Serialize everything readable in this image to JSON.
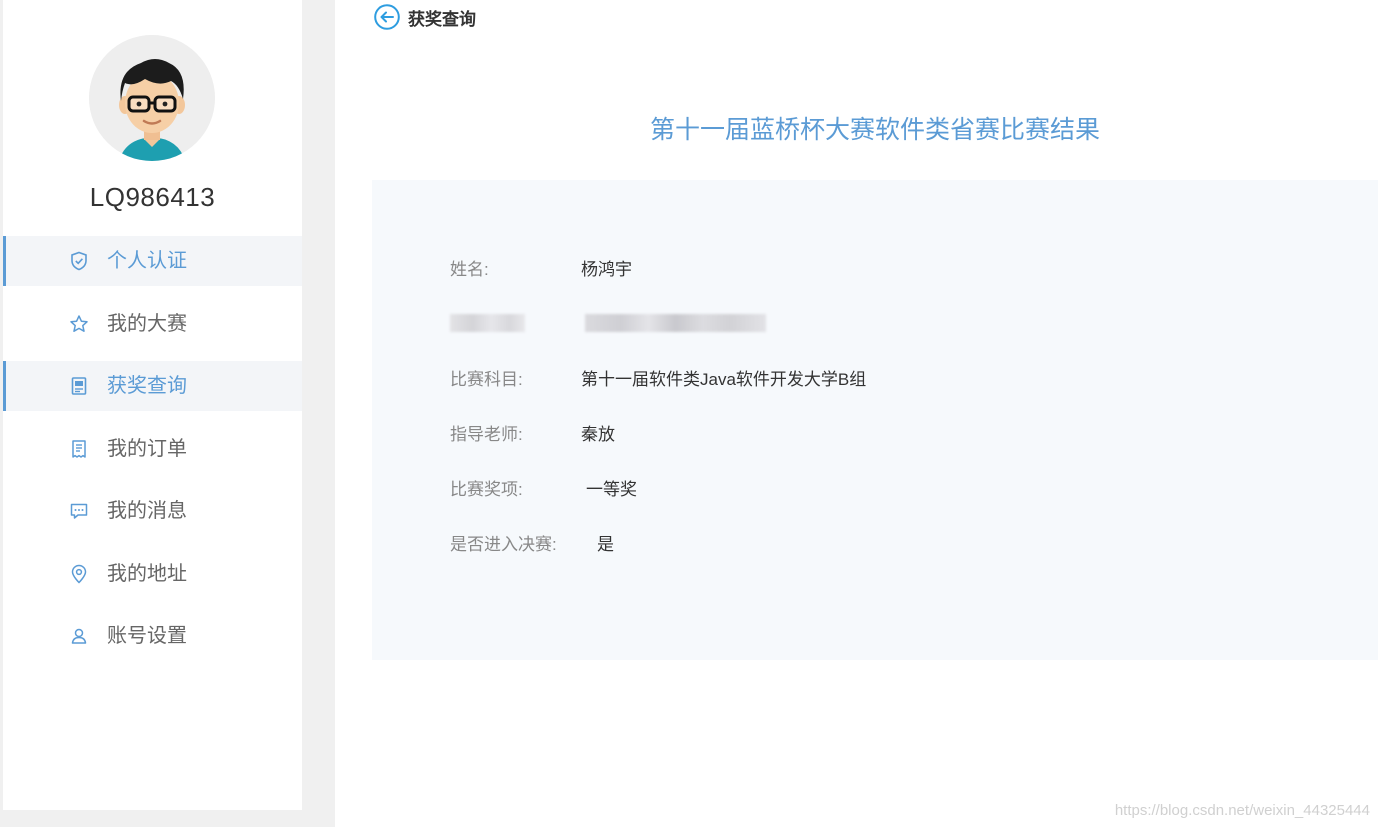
{
  "user": {
    "username": "LQ986413"
  },
  "sidebar": {
    "items": [
      {
        "label": "个人认证",
        "icon": "shield-check-icon",
        "active": true
      },
      {
        "label": "我的大赛",
        "icon": "star-icon",
        "active": false
      },
      {
        "label": "获奖查询",
        "icon": "document-icon",
        "active": true
      },
      {
        "label": "我的订单",
        "icon": "receipt-icon",
        "active": false
      },
      {
        "label": "我的消息",
        "icon": "message-icon",
        "active": false
      },
      {
        "label": "我的地址",
        "icon": "location-pin-icon",
        "active": false
      },
      {
        "label": "账号设置",
        "icon": "user-icon",
        "active": false
      }
    ]
  },
  "header": {
    "back_label": "获奖查询"
  },
  "result": {
    "title": "第十一届蓝桥杯大赛软件类省赛比赛结果",
    "fields": {
      "name_label": "姓名:",
      "name_value": "杨鸿宇",
      "subject_label": "比赛科目:",
      "subject_value": "第十一届软件类Java软件开发大学B组",
      "teacher_label": "指导老师:",
      "teacher_value": "秦放",
      "award_label": "比赛奖项:",
      "award_value": "一等奖",
      "final_label": "是否进入决赛:",
      "final_value": "是"
    }
  },
  "watermark": "https://blog.csdn.net/weixin_44325444",
  "colors": {
    "accent": "#5b9bd5",
    "panel_bg": "#f6f9fc",
    "page_bg": "#f0f0f0"
  }
}
